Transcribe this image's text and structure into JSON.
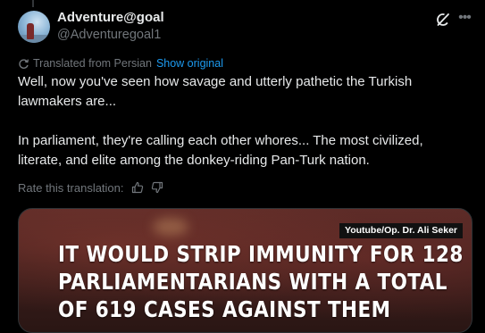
{
  "author": {
    "display_name": "Adventure@goal",
    "handle": "@Adventuregoal1"
  },
  "icons": {
    "grok": "grok-icon",
    "more": "more-icon",
    "translate": "translate-icon",
    "thumbs_up": "thumbs-up-icon",
    "thumbs_down": "thumbs-down-icon"
  },
  "translation": {
    "label": "Translated from Persian",
    "show_original": "Show original"
  },
  "tweet": {
    "paragraph1": "Well, now you've seen how savage and utterly pathetic the Turkish lawmakers are...",
    "paragraph2": "In parliament, they're calling each other whores... The most civilized, literate, and elite among the donkey-riding Pan-Turk nation."
  },
  "rating": {
    "label": "Rate this translation:"
  },
  "media": {
    "source_badge": "Youtube/Op. Dr. Ali Seker",
    "caption_lines": [
      "IT WOULD STRIP IMMUNITY FOR 128",
      "PARLIAMENTARIANS WITH A TOTAL",
      "OF 619 CASES AGAINST THEM"
    ]
  },
  "colors": {
    "background": "#000000",
    "text_primary": "#e7e9ea",
    "text_secondary": "#71767b",
    "link": "#1d9bf0"
  }
}
